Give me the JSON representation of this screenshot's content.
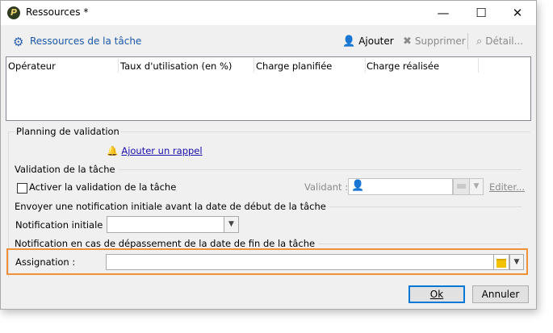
{
  "window": {
    "title": "Ressources *",
    "app_icon": "P",
    "minimize_glyph": "—",
    "maximize_glyph": "☐",
    "close_glyph": "✕"
  },
  "toolbar": {
    "left_label": "Ressources de la tâche",
    "left_icon": "gears-icon",
    "add_label": "Ajouter",
    "delete_label": "Supprimer",
    "detail_label": "Détail..."
  },
  "grid": {
    "columns": [
      "Opérateur",
      "Taux d'utilisation (en %)",
      "Charge planifiée",
      "Charge réalisée"
    ]
  },
  "planning": {
    "group_label": "Planning de validation",
    "add_reminder_link": "Ajouter un rappel",
    "validation_section": "Validation de la tâche",
    "enable_validation_label": "Activer la validation de la tâche",
    "enable_validation_checked": false,
    "validator_label": "Validant :",
    "edit_link": "Editer...",
    "initial_notification_section": "Envoyer une notification initiale avant la date de début de la tâche",
    "initial_notification_label": "Notification initiale :",
    "initial_notification_value": "",
    "overdue_section": "Notification en cas de dépassement de la date de fin de la tâche",
    "assignment_label": "Assignation :",
    "assignment_value": ""
  },
  "footer": {
    "ok_label": "Ok",
    "cancel_label": "Annuler"
  },
  "colors": {
    "highlight": "#f0903a",
    "link": "#1a0dab",
    "primary_border": "#0078d7"
  }
}
